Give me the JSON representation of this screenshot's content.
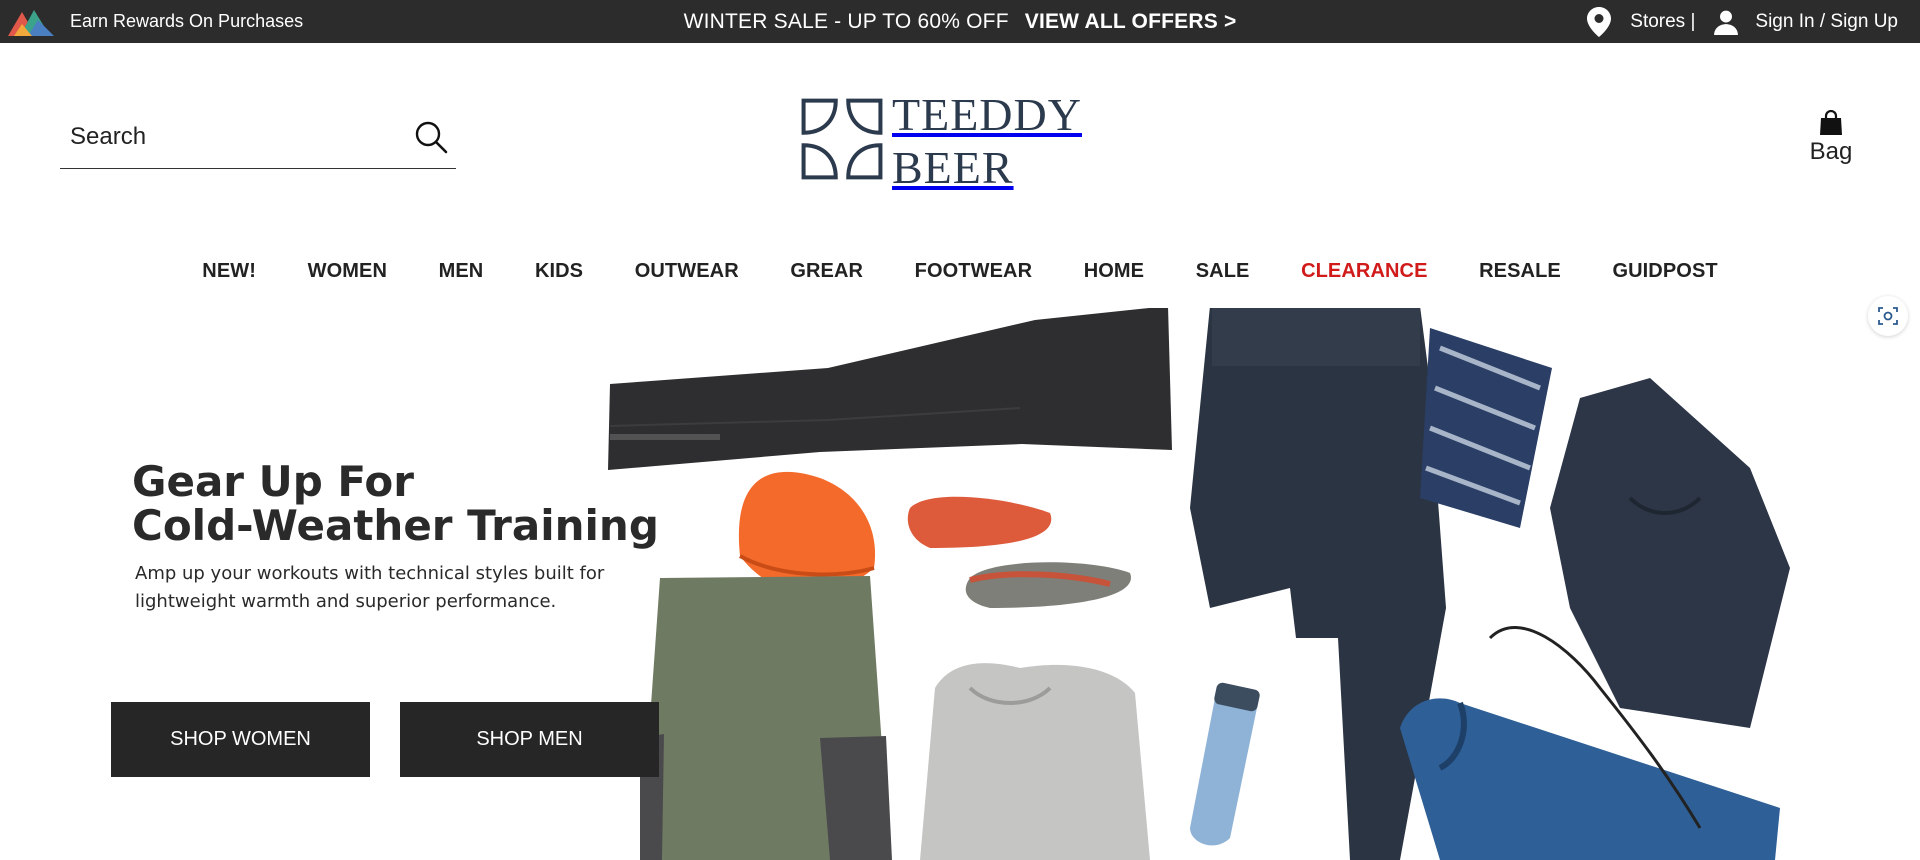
{
  "topbar": {
    "rewards_label": "Earn Rewards On Purchases",
    "promo_text": "WINTER SALE - UP TO 60% OFF",
    "promo_link": "VIEW ALL OFFERS >",
    "stores_label": "Stores |",
    "signin_label": "Sign In / Sign Up",
    "icons": [
      "mountain-logo-icon",
      "location-pin-icon",
      "user-icon"
    ]
  },
  "header": {
    "search": {
      "placeholder": "Search",
      "value": ""
    },
    "brand_name": "TEEDDY BEER",
    "bag_label": "Bag",
    "icons": [
      "search-icon",
      "bag-icon",
      "logo-mark-icon"
    ]
  },
  "nav": {
    "items": [
      {
        "label": "NEW!"
      },
      {
        "label": "WOMEN"
      },
      {
        "label": "MEN"
      },
      {
        "label": "KIDS"
      },
      {
        "label": "OUTWEAR"
      },
      {
        "label": "GREAR"
      },
      {
        "label": "FOOTWEAR"
      },
      {
        "label": "HOME"
      },
      {
        "label": "SALE"
      },
      {
        "label": "CLEARANCE"
      },
      {
        "label": "RESALE"
      },
      {
        "label": "GUIDPOST"
      }
    ],
    "highlight_color": "#d11b1b"
  },
  "hero": {
    "title_line1": "Gear Up For",
    "title_line2": "Cold-Weather Training",
    "subtitle": "Amp up your workouts with technical styles built for lightweight warmth and superior performance.",
    "buttons": {
      "women": "SHOP WOMEN",
      "men": "SHOP MEN"
    }
  },
  "colors": {
    "topbar_bg": "#2c2c2c",
    "button_bg": "#262626",
    "brand_navy": "#2c3a4e",
    "clearance_red": "#d11b1b"
  }
}
